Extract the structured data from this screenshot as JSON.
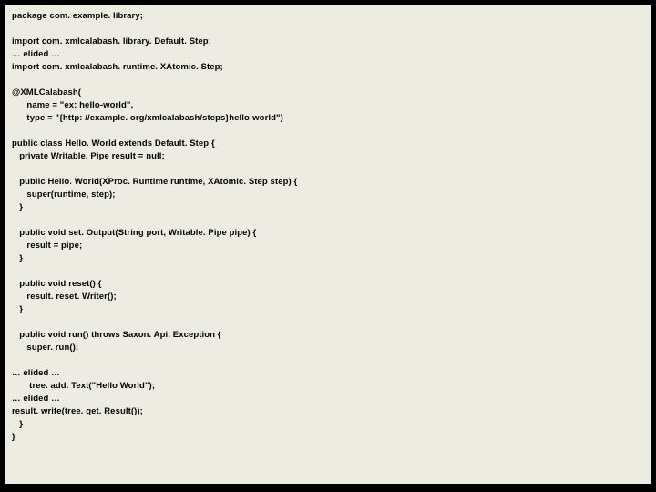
{
  "code": {
    "l01": "package com. example. library;",
    "l02": "",
    "l03": "import com. xmlcalabash. library. Default. Step;",
    "l04": "… elided …",
    "l05": "import com. xmlcalabash. runtime. XAtomic. Step;",
    "l06": "",
    "l07": "@XMLCalabash(",
    "l08": "      name = \"ex: hello-world\",",
    "l09": "      type = \"{http: //example. org/xmlcalabash/steps}hello-world\")",
    "l10": "",
    "l11": "public class Hello. World extends Default. Step {",
    "l12": "   private Writable. Pipe result = null;",
    "l13": "",
    "l14": "   public Hello. World(XProc. Runtime runtime, XAtomic. Step step) {",
    "l15": "      super(runtime, step);",
    "l16": "   }",
    "l17": "",
    "l18": "   public void set. Output(String port, Writable. Pipe pipe) {",
    "l19": "      result = pipe;",
    "l20": "   }",
    "l21": "",
    "l22": "   public void reset() {",
    "l23": "      result. reset. Writer();",
    "l24": "   }",
    "l25": "",
    "l26": "   public void run() throws Saxon. Api. Exception {",
    "l27": "      super. run();",
    "l28": "",
    "l29": "… elided …",
    "l30": "       tree. add. Text(\"Hello World\");",
    "l31": "… elided …",
    "l32": "result. write(tree. get. Result());",
    "l33": "   }",
    "l34": "}"
  }
}
